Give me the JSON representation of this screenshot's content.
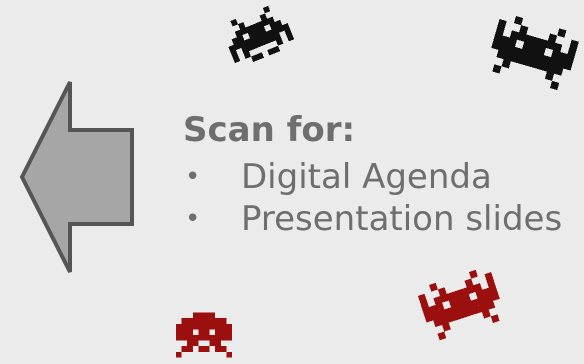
{
  "heading": "Scan for:",
  "bullets": [
    {
      "marker": "•",
      "text": "Digital Agenda"
    },
    {
      "marker": "•",
      "text": "Presentation slides"
    }
  ],
  "decorations": {
    "arrow": {
      "direction": "left",
      "fill": "#a6a6a6",
      "stroke": "#555555"
    },
    "invaders": [
      {
        "name": "black-invader",
        "color": "#111111"
      },
      {
        "name": "black-invader",
        "color": "#111111"
      },
      {
        "name": "red-invader",
        "color": "#9b0f0f"
      },
      {
        "name": "red-invader",
        "color": "#9b0f0f"
      }
    ]
  },
  "colors": {
    "background": "#ebebeb",
    "text": "#6e6e6e"
  }
}
